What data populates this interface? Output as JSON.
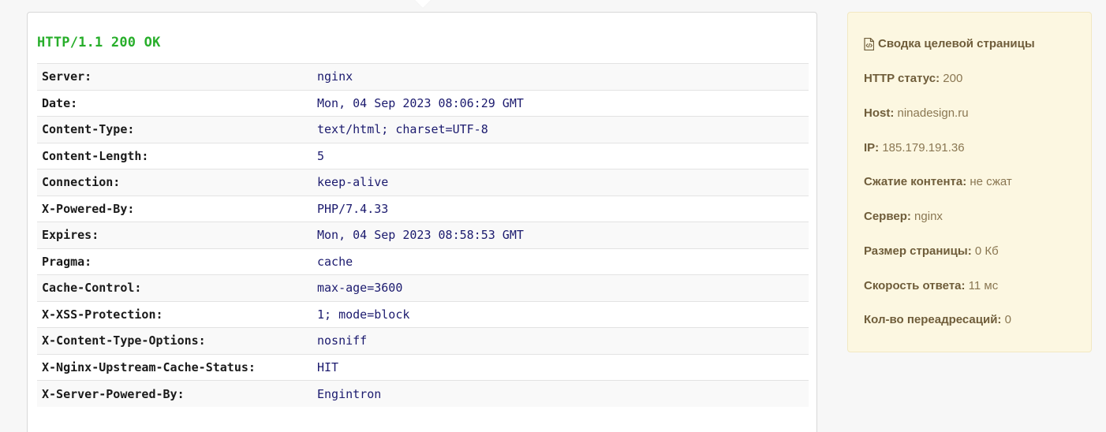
{
  "status_line": "HTTP/1.1 200 OK",
  "headers": [
    {
      "name": "Server:",
      "value": "nginx"
    },
    {
      "name": "Date:",
      "value": "Mon, 04 Sep 2023 08:06:29 GMT"
    },
    {
      "name": "Content-Type:",
      "value": "text/html; charset=UTF-8"
    },
    {
      "name": "Content-Length:",
      "value": "5"
    },
    {
      "name": "Connection:",
      "value": "keep-alive"
    },
    {
      "name": "X-Powered-By:",
      "value": "PHP/7.4.33"
    },
    {
      "name": "Expires:",
      "value": "Mon, 04 Sep 2023 08:58:53 GMT"
    },
    {
      "name": "Pragma:",
      "value": "cache"
    },
    {
      "name": "Cache-Control:",
      "value": "max-age=3600"
    },
    {
      "name": "X-XSS-Protection:",
      "value": "1; mode=block"
    },
    {
      "name": "X-Content-Type-Options:",
      "value": "nosniff"
    },
    {
      "name": "X-Nginx-Upstream-Cache-Status:",
      "value": "HIT"
    },
    {
      "name": "X-Server-Powered-By:",
      "value": "Engintron"
    }
  ],
  "summary": {
    "title": "Сводка целевой страницы",
    "title_icon": "file-code-icon",
    "items": [
      {
        "label": "HTTP статус:",
        "value": "200"
      },
      {
        "label": "Host:",
        "value": "ninadesign.ru"
      },
      {
        "label": "IP:",
        "value": "185.179.191.36"
      },
      {
        "label": "Сжатие контента:",
        "value": "не сжат"
      },
      {
        "label": "Сервер:",
        "value": "nginx"
      },
      {
        "label": "Размер страницы:",
        "value": "0 Кб"
      },
      {
        "label": "Скорость ответа:",
        "value": "11 мс"
      },
      {
        "label": "Кол-во переадресаций:",
        "value": "0"
      }
    ]
  },
  "colors": {
    "status_ok": "#27ae2a",
    "header_value": "#1b1a6e",
    "summary_background": "#fcf7e1",
    "summary_text": "#7d6a45"
  }
}
